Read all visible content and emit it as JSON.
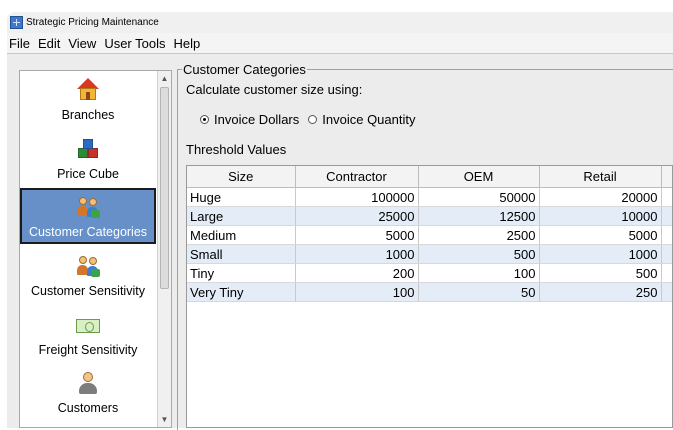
{
  "window": {
    "title": "Strategic Pricing Maintenance"
  },
  "menu": [
    "File",
    "Edit",
    "View",
    "User Tools",
    "Help"
  ],
  "sidebar": {
    "items": [
      {
        "label": "Branches",
        "icon": "house-icon"
      },
      {
        "label": "Price Cube",
        "icon": "cube-icon"
      },
      {
        "label": "Customer Categories",
        "icon": "people-icon",
        "selected": true
      },
      {
        "label": "Customer Sensitivity",
        "icon": "people-icon"
      },
      {
        "label": "Freight Sensitivity",
        "icon": "money-icon"
      },
      {
        "label": "Customers",
        "icon": "user-icon"
      }
    ],
    "selected_color": "#6790c8"
  },
  "main": {
    "group_title": "Customer Categories",
    "calc_label": "Calculate customer size using:",
    "options": [
      {
        "label": "Invoice Dollars",
        "selected": true
      },
      {
        "label": "Invoice Quantity",
        "selected": false
      }
    ],
    "threshold_label": "Threshold Values",
    "table": {
      "columns": [
        "Size",
        "Contractor",
        "OEM",
        "Retail"
      ],
      "rows": [
        [
          "Huge",
          "100000",
          "50000",
          "20000"
        ],
        [
          "Large",
          "25000",
          "12500",
          "10000"
        ],
        [
          "Medium",
          "5000",
          "2500",
          "5000"
        ],
        [
          "Small",
          "1000",
          "500",
          "1000"
        ],
        [
          "Tiny",
          "200",
          "100",
          "500"
        ],
        [
          "Very Tiny",
          "100",
          "50",
          "250"
        ]
      ],
      "alt_row_color": "#e3ecf7"
    }
  }
}
